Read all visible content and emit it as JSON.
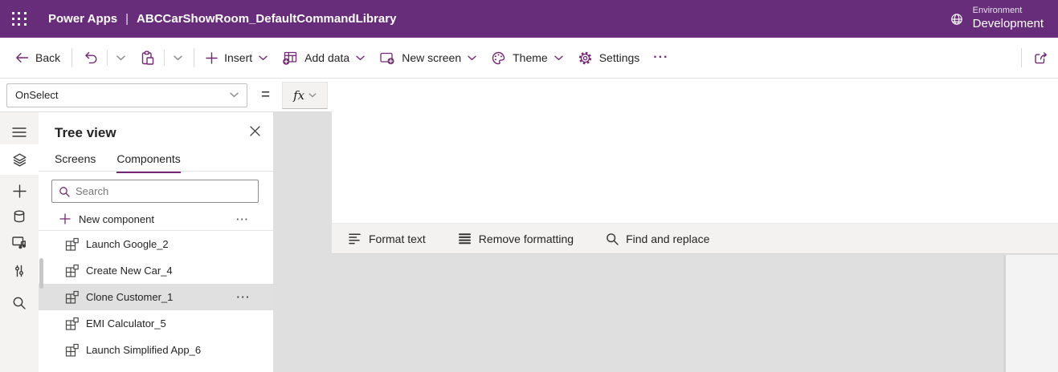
{
  "colors": {
    "brand_purple": "#672d7a",
    "accent_purple": "#742774",
    "canvas_gray": "#dfdfdf",
    "selected_row_gray": "#e0e0e0",
    "toolbar_bg": "#f3f2f1"
  },
  "topbar": {
    "product": "Power Apps",
    "divider": "|",
    "app_name": "ABCCarShowRoom_DefaultCommandLibrary",
    "environment_label": "Environment",
    "environment_name": "Development"
  },
  "commandbar": {
    "back": "Back",
    "insert": "Insert",
    "add_data": "Add data",
    "new_screen": "New screen",
    "theme": "Theme",
    "settings": "Settings",
    "overflow": "···"
  },
  "formula_bar": {
    "property": "OnSelect",
    "equals": "=",
    "fx_label": "fx"
  },
  "tree_view": {
    "title": "Tree view",
    "tab_screens": "Screens",
    "tab_components": "Components",
    "search_placeholder": "Search",
    "new_component": "New component",
    "more": "···",
    "items": [
      {
        "label": "Launch Google_2",
        "selected": false
      },
      {
        "label": "Create New Car_4",
        "selected": false
      },
      {
        "label": "Clone Customer_1",
        "selected": true
      },
      {
        "label": "EMI Calculator_5",
        "selected": false
      },
      {
        "label": "Launch Simplified App_6",
        "selected": false
      }
    ]
  },
  "editor_toolbar": {
    "format_text": "Format text",
    "remove_formatting": "Remove formatting",
    "find_and_replace": "Find and replace"
  }
}
